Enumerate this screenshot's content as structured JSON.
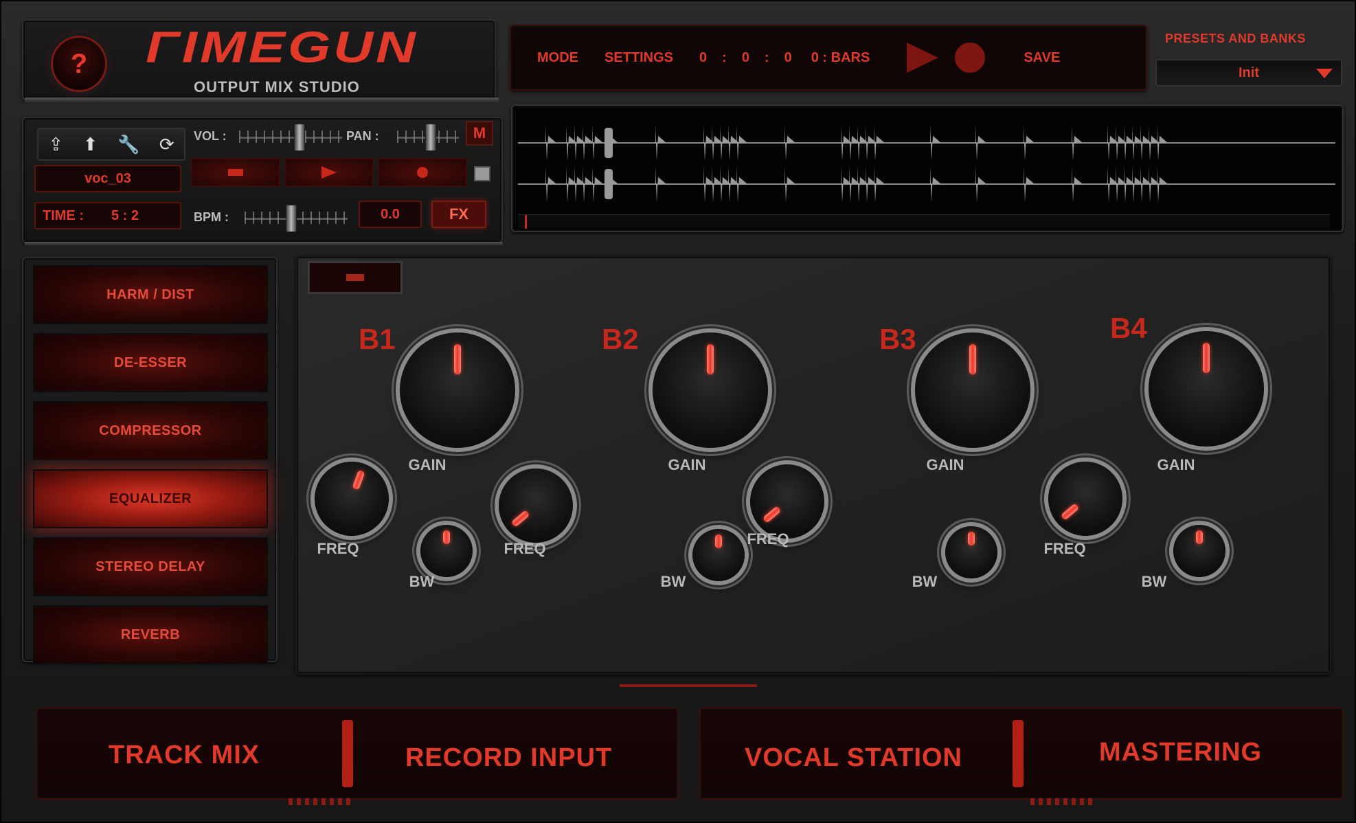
{
  "header": {
    "help_label": "?",
    "brand": "ΓIMEGUN",
    "subtitle": "OUTPUT MIX STUDIO"
  },
  "transport": {
    "mode_label": "MODE",
    "settings_label": "SETTINGS",
    "counter": [
      "0",
      ":",
      "0",
      ":",
      "0"
    ],
    "bars_label": "0 : BARS",
    "save_label": "SAVE"
  },
  "presets": {
    "label": "PRESETS AND BANKS",
    "selected": "Init"
  },
  "controls": {
    "vol_label": "VOL :",
    "pan_label": "PAN :",
    "mute_label": "M",
    "file_name": "voc_03",
    "time_label": "TIME :",
    "time_value": "5 : 2",
    "bpm_label": "BPM :",
    "bpm_value": "0.0",
    "fx_label": "FX",
    "vol_level": 0.6,
    "pan_level": 0.55,
    "bpm_level": 0.45
  },
  "fx_list": {
    "items": [
      {
        "label": "HARM / DIST",
        "active": false
      },
      {
        "label": "DE-ESSER",
        "active": false
      },
      {
        "label": "COMPRESSOR",
        "active": false
      },
      {
        "label": "EQUALIZER",
        "active": true
      },
      {
        "label": "STEREO DELAY",
        "active": false
      },
      {
        "label": "REVERB",
        "active": false
      }
    ]
  },
  "eq": {
    "bands": [
      {
        "name": "B1",
        "gain_label": "GAIN",
        "freq_label": "FREQ",
        "bw_label": "BW",
        "gain_angle": 0,
        "freq_angle": 20,
        "bw_angle": 0
      },
      {
        "name": "B2",
        "gain_label": "GAIN",
        "freq_label": "FREQ",
        "bw_label": "BW",
        "gain_angle": 0,
        "freq_angle": -130,
        "bw_angle": 0
      },
      {
        "name": "B3",
        "gain_label": "GAIN",
        "freq_label": "FREQ",
        "bw_label": "BW",
        "gain_angle": 0,
        "freq_angle": -130,
        "bw_angle": 0
      },
      {
        "name": "B4",
        "gain_label": "GAIN",
        "freq_label": "FREQ",
        "bw_label": "BW",
        "gain_angle": 0,
        "freq_angle": -130,
        "bw_angle": 0
      }
    ]
  },
  "nav": {
    "track_mix": "TRACK MIX",
    "record_input": "RECORD INPUT",
    "vocal_station": "VOCAL STATION",
    "mastering": "MASTERING"
  },
  "colors": {
    "accent": "#e03a2c",
    "panel": "#1c1c1c",
    "label_grey": "#b9b9b9"
  },
  "icons": [
    "question-icon",
    "export-icon",
    "upload-icon",
    "wrench-icon",
    "refresh-icon",
    "play-icon",
    "record-icon",
    "stop-icon",
    "chevron-down-icon"
  ]
}
